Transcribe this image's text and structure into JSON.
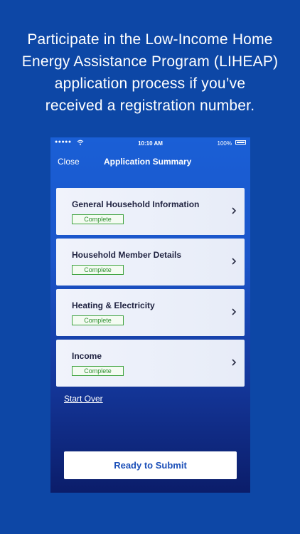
{
  "headline": {
    "lines": [
      "Participate in the Low-Income Home",
      "Energy Assistance Program (LIHEAP)",
      "application process if you’ve",
      "received a registration number."
    ]
  },
  "status_bar": {
    "signal": "●●●●●",
    "time": "10:10 AM",
    "battery": "100%"
  },
  "nav": {
    "close_label": "Close",
    "title": "Application Summary"
  },
  "sections": [
    {
      "label": "General Household Information",
      "status": "Complete"
    },
    {
      "label": "Household Member Details",
      "status": "Complete"
    },
    {
      "label": "Heating & Electricity",
      "status": "Complete"
    },
    {
      "label": "Income",
      "status": "Complete"
    }
  ],
  "start_over_label": "Start Over",
  "submit_label": "Ready to Submit",
  "colors": {
    "background": "#0d47a6",
    "complete_green": "#3fa33f",
    "submit_text": "#1b4fb8"
  }
}
